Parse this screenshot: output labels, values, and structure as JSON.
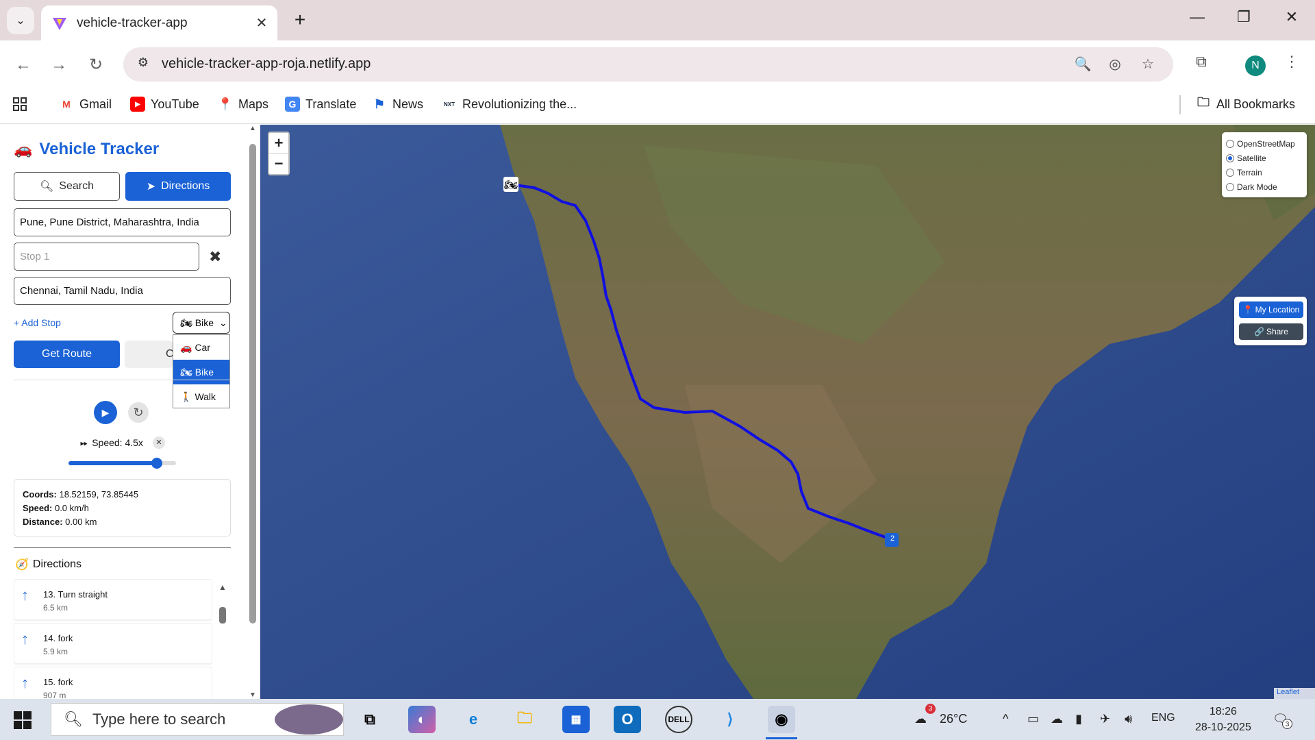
{
  "browser": {
    "tab_title": "vehicle-tracker-app",
    "url": "vehicle-tracker-app-roja.netlify.app",
    "avatar_letter": "N",
    "bookmarks": [
      {
        "label": "Gmail",
        "icon": "gmail-icon"
      },
      {
        "label": "YouTube",
        "icon": "youtube-icon"
      },
      {
        "label": "Maps",
        "icon": "maps-icon"
      },
      {
        "label": "Translate",
        "icon": "translate-icon"
      },
      {
        "label": "News",
        "icon": "news-icon"
      },
      {
        "label": "Revolutionizing the...",
        "icon": "nextwave-icon"
      }
    ],
    "all_bookmarks": "All Bookmarks"
  },
  "app": {
    "title": "Vehicle Tracker",
    "tabs": {
      "search": "Search",
      "directions": "Directions"
    },
    "start_value": "Pune, Pune District, Maharashtra, India",
    "stop_placeholder": "Stop 1",
    "end_value": "Chennai, Tamil Nadu, India",
    "add_stop": "+ Add Stop",
    "vehicle_selected": "Bike",
    "vehicle_options": [
      {
        "label": "Car",
        "icon": "🚗"
      },
      {
        "label": "Bike",
        "icon": "🏍"
      },
      {
        "label": "Walk",
        "icon": "🚶"
      }
    ],
    "get_route": "Get Route",
    "clear_label": "C",
    "speed_label": "Speed: 4.5x",
    "speed_fraction": 0.82,
    "stats": {
      "coords_label": "Coords:",
      "coords_value": "18.52159, 73.85445",
      "speed_label": "Speed:",
      "speed_value": "0.0 km/h",
      "distance_label": "Distance:",
      "distance_value": "0.00 km"
    },
    "directions_title": "Directions",
    "directions": [
      {
        "text": "13. Turn straight",
        "dist": "6.5 km"
      },
      {
        "text": "14. fork",
        "dist": "5.9 km"
      },
      {
        "text": "15. fork",
        "dist": "907 m"
      }
    ]
  },
  "map": {
    "zoom_in": "+",
    "zoom_out": "−",
    "layers": [
      {
        "label": "OpenStreetMap",
        "checked": false
      },
      {
        "label": "Satellite",
        "checked": true
      },
      {
        "label": "Terrain",
        "checked": false
      },
      {
        "label": "Dark Mode",
        "checked": false
      }
    ],
    "my_location": "My Location",
    "share": "Share",
    "end_marker": "2",
    "attribution": "Leaflet",
    "route_color": "#1010e0"
  },
  "taskbar": {
    "search_placeholder": "Type here to search",
    "weather_temp": "26°C",
    "weather_badge": "3",
    "language": "ENG",
    "time": "18:26",
    "date": "28-10-2025",
    "notif_count": "3"
  }
}
